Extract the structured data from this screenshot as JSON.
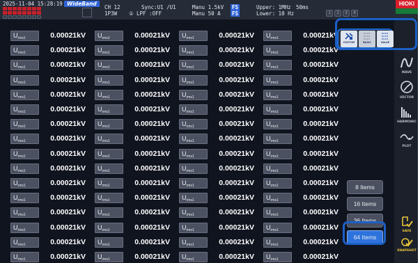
{
  "status": {
    "datetime": "2025-11-04 15:28:19",
    "mode_badge": "WideBand",
    "channel": "CH 12",
    "wiring": "1P3W",
    "sync": "Sync:U1  /U1",
    "lpf_num": "①",
    "lpf": "LPF :OFF",
    "manu_v": "Manu  1.5kV",
    "manu_a": "Manu  50 A",
    "fs": "FS",
    "upper": "Upper:  1MHz",
    "lower": "Lower: 10 Hz",
    "interval": "50ms",
    "hold_pills": [
      "1",
      "2",
      "3",
      "4"
    ]
  },
  "brand": {
    "logo": "HIOKI"
  },
  "display_modes": [
    {
      "name": "CUSTOM"
    },
    {
      "name": "BASIC"
    },
    {
      "name": "VALUE"
    }
  ],
  "sidebar": [
    {
      "name": "WAVE"
    },
    {
      "name": "VECTOR"
    },
    {
      "name": "HARMONIC"
    },
    {
      "name": "PLOT"
    },
    {
      "name": "SAVE"
    },
    {
      "name": "SNAPSHOT"
    }
  ],
  "item_buttons": [
    "8 Items",
    "16 Items",
    "36 Items",
    "64 Items"
  ],
  "active_items": "64 Items",
  "param": {
    "symbol": "U",
    "sub": "rms1"
  },
  "measurement_value": "0.00021kV",
  "grid": {
    "rows": 16,
    "columns": 4
  }
}
